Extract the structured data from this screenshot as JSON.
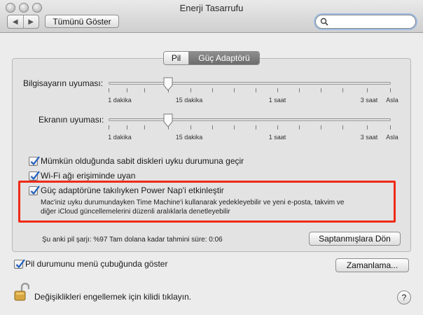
{
  "window": {
    "title": "Enerji Tasarrufu",
    "show_all_button": "Tümünü Göster",
    "nav": {
      "back": "◀",
      "forward": "▶"
    },
    "search": {
      "placeholder": ""
    }
  },
  "tabs": [
    {
      "label": "Pil",
      "selected": false
    },
    {
      "label": "Güç Adaptörü",
      "selected": true
    }
  ],
  "sliders": [
    {
      "label": "Bilgisayarın uyuması:",
      "ticks": [
        "1 dakika",
        "15 dakika",
        "1 saat",
        "3 saat",
        "Asla"
      ],
      "value_label": "15 dakika"
    },
    {
      "label": "Ekranın uyuması:",
      "ticks": [
        "1 dakika",
        "15 dakika",
        "1 saat",
        "3 saat",
        "Asla"
      ],
      "value_label": "15 dakika"
    }
  ],
  "checkboxes": [
    {
      "label": "Mümkün olduğunda sabit diskleri uyku durumuna geçir",
      "checked": true
    },
    {
      "label": "Wi-Fi ağı erişiminde uyan",
      "checked": true
    },
    {
      "label": "Güç adaptörüne takılıyken Power Nap'i etkinleştir",
      "checked": true,
      "description_line1": "Mac'iniz uyku durumundayken Time Machine'i kullanarak yedekleyebilir ve yeni e-posta, takvim ve",
      "description_line2": "diğer iCloud güncellemelerini düzenli aralıklarla denetleyebilir"
    }
  ],
  "status": {
    "charge_text": "Şu anki pil şarjı: %97  Tam dolana kadar tahmini süre: 0:06"
  },
  "buttons": {
    "restore_defaults": "Saptanmışlara Dön",
    "schedule": "Zamanlama..."
  },
  "menu_bar_option": {
    "label": "Pil durumunu menü çubuğunda göster",
    "checked": true
  },
  "footer": {
    "lock_text": "Değişiklikleri engellemek için kilidi tıklayın.",
    "help": "?"
  },
  "colors": {
    "highlight": "#f02a17",
    "selected_tab": "#7a7a7a",
    "check": "#1f5fbf"
  }
}
